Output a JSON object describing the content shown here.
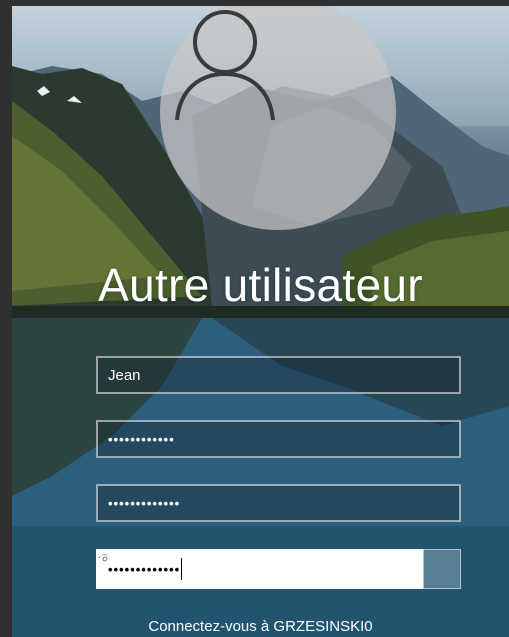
{
  "login": {
    "display_name": "Autre utilisateur",
    "username_value": "Jean",
    "password1_mask": "••••••••••••",
    "password2_mask": "•••••••••••••",
    "password3_mask": "•••••••••••••",
    "connect_text": "Connectez-vous à GRZESINSKI0"
  },
  "icons": {
    "avatar": "user-silhouette-icon",
    "reveal": "eye-icon",
    "submit": "arrow-right-icon"
  },
  "colors": {
    "field_border": "#ffffff",
    "active_field_bg": "#ffffff",
    "text": "#ffffff"
  }
}
